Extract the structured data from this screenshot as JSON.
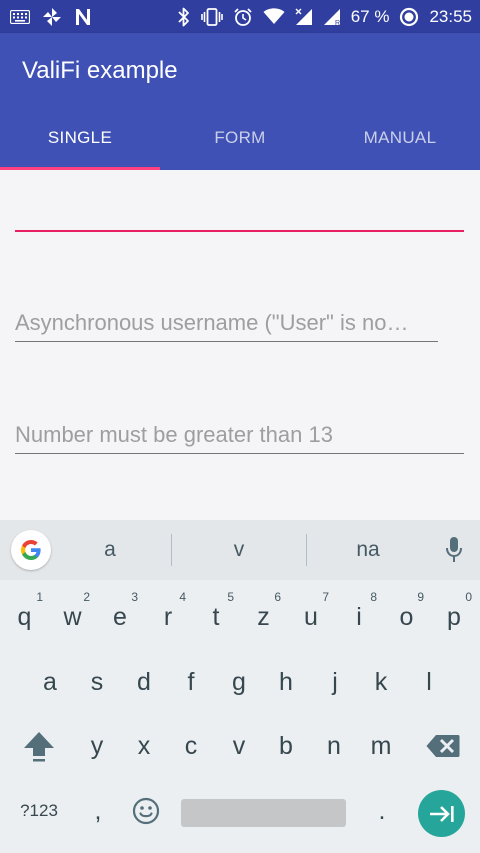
{
  "status_bar": {
    "battery": "67 %",
    "time": "23:55",
    "icons": [
      "keyboard-icon",
      "pinwheel-icon",
      "n-app-icon",
      "bluetooth-icon",
      "vibrate-icon",
      "alarm-icon",
      "wifi-icon",
      "signal-no-data-icon",
      "signal-roaming-icon",
      "battery-icon"
    ]
  },
  "app_bar": {
    "title": "ValiFi example",
    "tabs": [
      {
        "label": "SINGLE",
        "active": true
      },
      {
        "label": "FORM",
        "active": false
      },
      {
        "label": "MANUAL",
        "active": false
      }
    ]
  },
  "form": {
    "field_1": {
      "value": "",
      "placeholder": ""
    },
    "field_2": {
      "value": "",
      "placeholder": "Asynchronous username (\"User\" is no…"
    },
    "field_3": {
      "value": "",
      "placeholder": "Number must be greater than 13"
    }
  },
  "colors": {
    "status_bar": "#303f9f",
    "app_bar": "#3f51b5",
    "accent": "#ff4081",
    "enter_key": "#26a69a"
  },
  "keyboard": {
    "suggestions": [
      "a",
      "v",
      "na"
    ],
    "row_1": [
      {
        "key": "q",
        "hint": "1"
      },
      {
        "key": "w",
        "hint": "2"
      },
      {
        "key": "e",
        "hint": "3"
      },
      {
        "key": "r",
        "hint": "4"
      },
      {
        "key": "t",
        "hint": "5"
      },
      {
        "key": "z",
        "hint": "6"
      },
      {
        "key": "u",
        "hint": "7"
      },
      {
        "key": "i",
        "hint": "8"
      },
      {
        "key": "o",
        "hint": "9"
      },
      {
        "key": "p",
        "hint": "0"
      }
    ],
    "row_2": [
      "a",
      "s",
      "d",
      "f",
      "g",
      "h",
      "j",
      "k",
      "l"
    ],
    "row_3": [
      "y",
      "x",
      "c",
      "v",
      "b",
      "n",
      "m"
    ],
    "row_4": {
      "symbols": "?123",
      "comma": ",",
      "period": "."
    }
  }
}
